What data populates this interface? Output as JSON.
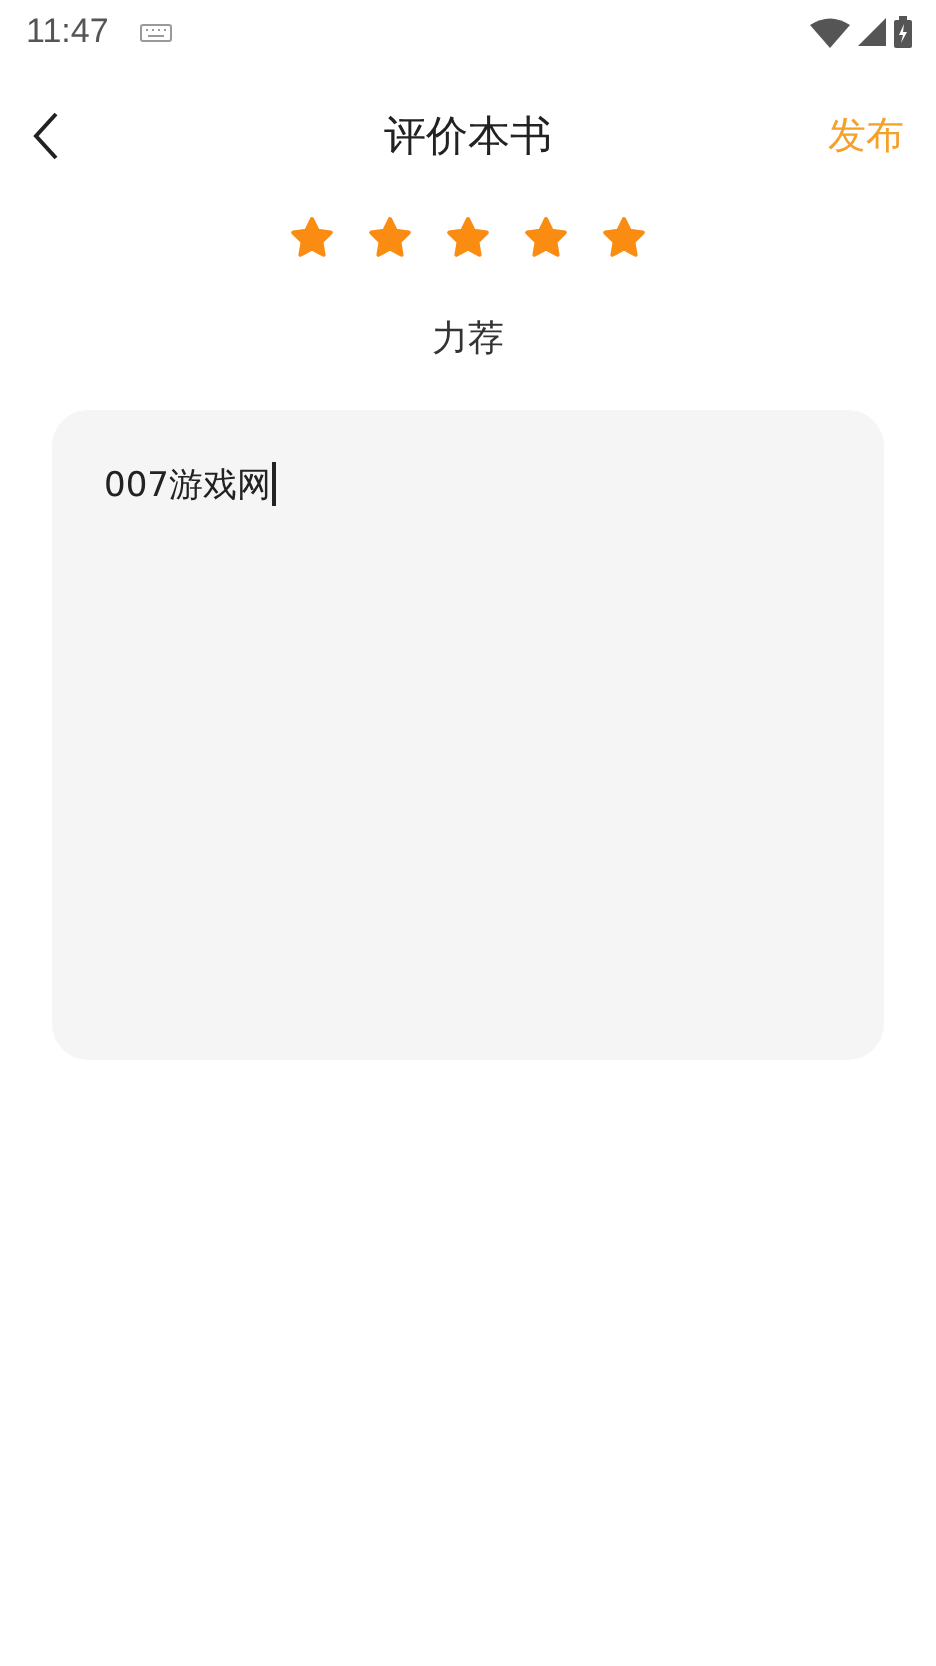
{
  "status_bar": {
    "time": "11:47"
  },
  "header": {
    "title": "评价本书",
    "action": "发布"
  },
  "rating": {
    "stars": 5,
    "label": "力荐"
  },
  "review": {
    "value": "007游戏网"
  }
}
